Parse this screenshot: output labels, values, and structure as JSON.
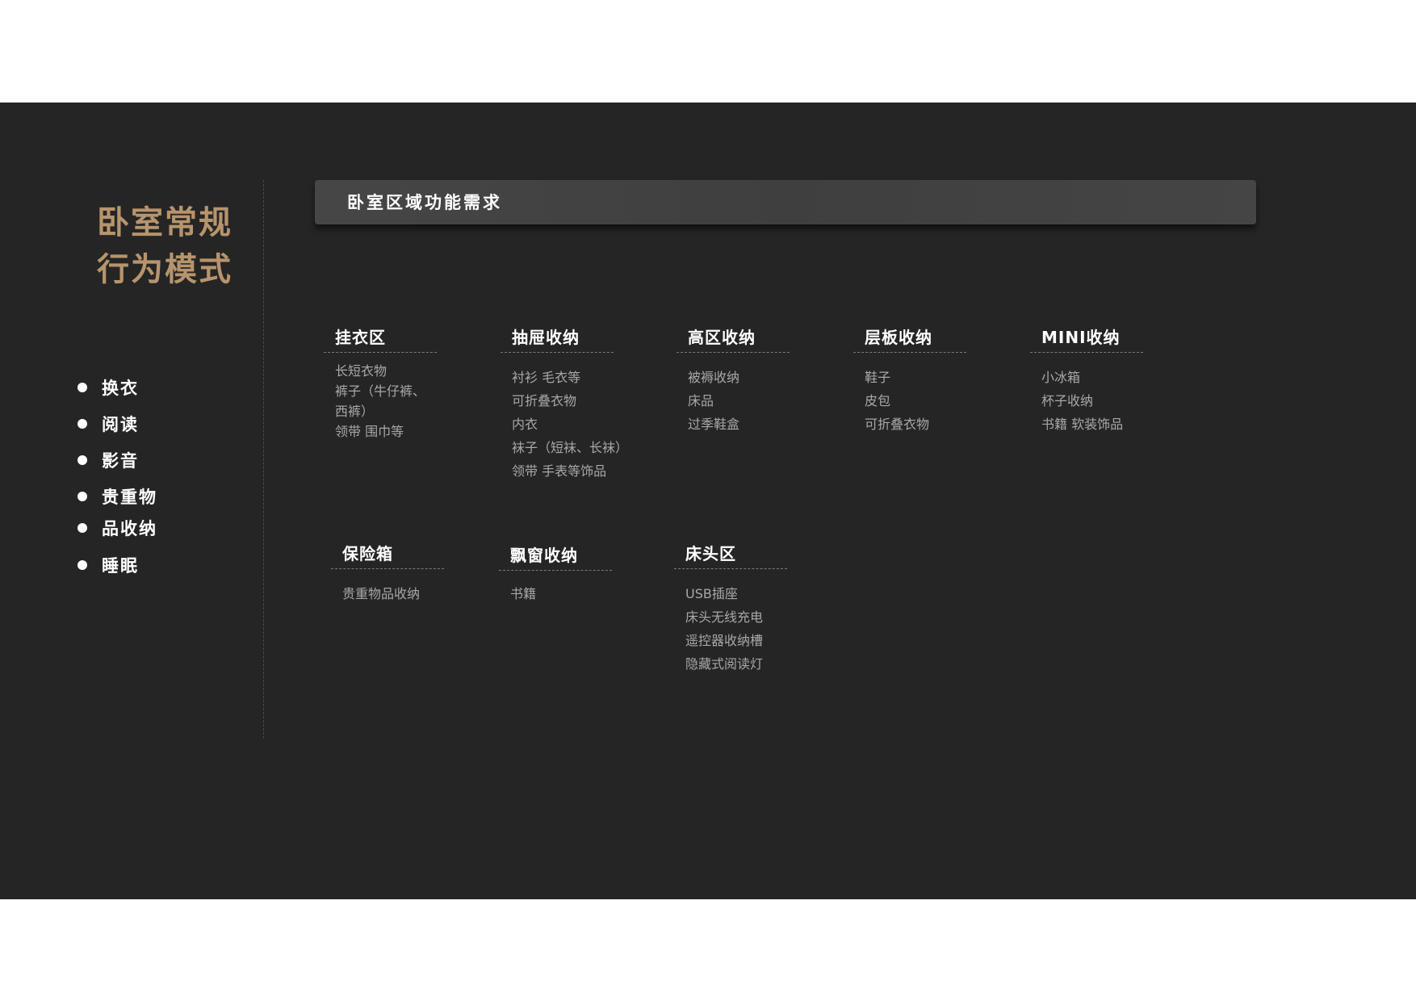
{
  "sidebar": {
    "title_line1": "卧室常规",
    "title_line2": "行为模式",
    "behaviors": [
      "换衣",
      "阅读",
      "影音",
      "贵重物",
      "品收纳",
      "睡眠"
    ]
  },
  "header": {
    "title": "卧室区域功能需求"
  },
  "zones": [
    {
      "title": "挂衣区",
      "items": [
        "长短衣物",
        "裤子（牛仔裤、",
        "西裤）",
        "领带 围巾等"
      ]
    },
    {
      "title": "抽屉收纳",
      "items": [
        "衬衫  毛衣等",
        "可折叠衣物",
        "内衣",
        "袜子（短袜、长袜）",
        "领带  手表等饰品"
      ]
    },
    {
      "title": "高区收纳",
      "items": [
        "被褥收纳",
        "床品",
        "过季鞋盒"
      ]
    },
    {
      "title": "层板收纳",
      "items": [
        "鞋子",
        "皮包",
        "可折叠衣物"
      ]
    },
    {
      "title": "MINI收纳",
      "items": [
        "小冰箱",
        "杯子收纳",
        "书籍  软装饰品"
      ]
    },
    {
      "title": "保险箱",
      "items": [
        "贵重物品收纳"
      ]
    },
    {
      "title": "飘窗收纳",
      "items": [
        "书籍"
      ]
    },
    {
      "title": "床头区",
      "items": [
        "USB插座",
        "床头无线充电",
        "遥控器收纳槽",
        "隐藏式阅读灯"
      ]
    }
  ]
}
